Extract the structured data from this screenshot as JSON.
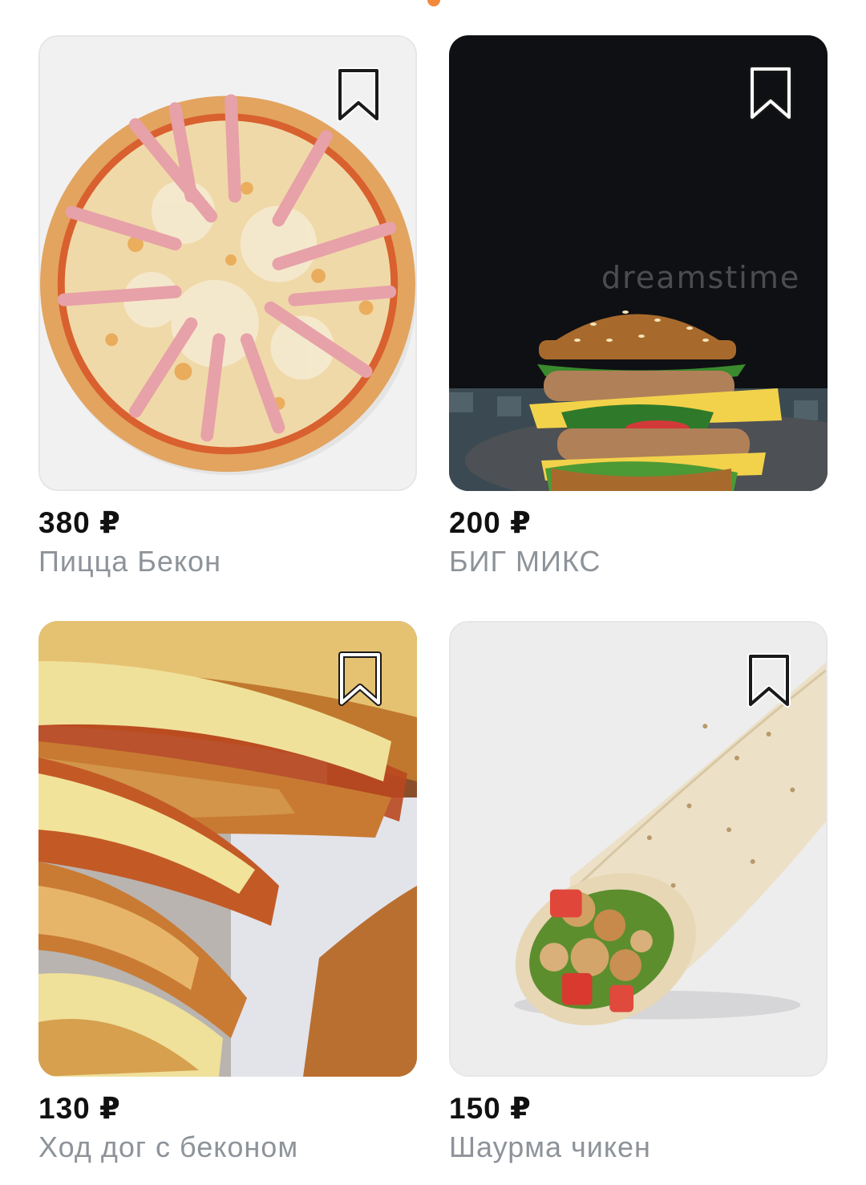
{
  "products": [
    {
      "price": "380 ₽",
      "name": "Пицца Бекон",
      "image_icon": "pizza-image"
    },
    {
      "price": "200 ₽",
      "name": "БИГ МИКС",
      "image_icon": "burger-image",
      "watermark": "dreamstime"
    },
    {
      "price": "130 ₽",
      "name": "Ход дог с беконом",
      "image_icon": "hotdog-image"
    },
    {
      "price": "150 ₽",
      "name": "Шаурма чикен",
      "image_icon": "shawarma-image"
    }
  ],
  "colors": {
    "scroll_indicator": "#f08a3c",
    "price_text": "#111111",
    "name_text": "#8d9399",
    "card_border": "#e6e6e8"
  }
}
